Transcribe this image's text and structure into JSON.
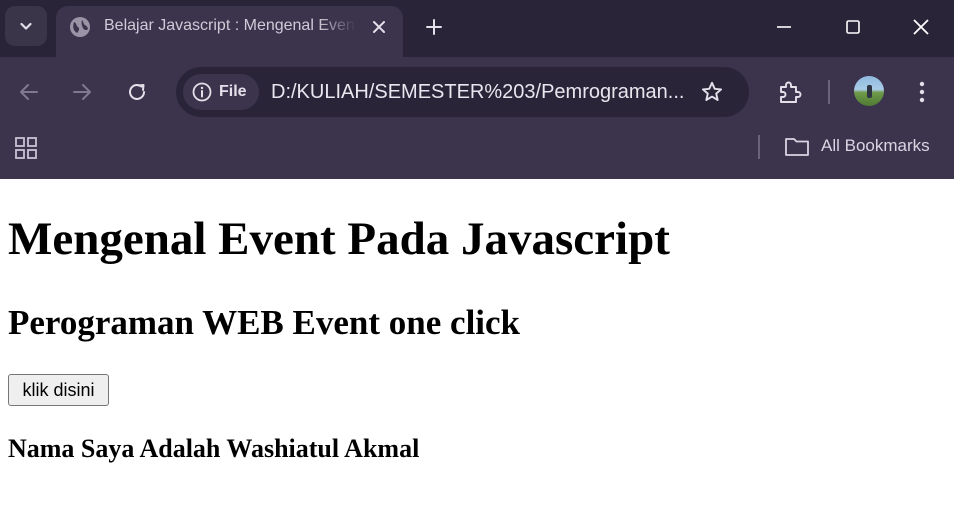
{
  "browser": {
    "tab": {
      "title": "Belajar Javascript : Mengenal Event Pada Javascript"
    },
    "address_bar": {
      "site_info_label": "File",
      "url": "D:/KULIAH/SEMESTER%203/Pemrograman..."
    },
    "bookmarks_bar": {
      "all_bookmarks_label": "All Bookmarks"
    },
    "icons": {
      "tab_search": "chevron-down-icon",
      "favicon": "globe-icon",
      "tab_close": "close-icon",
      "new_tab": "plus-icon",
      "minimize": "minimize-icon",
      "maximize": "maximize-icon",
      "close_window": "close-icon",
      "back": "arrow-left-icon",
      "forward": "arrow-right-icon",
      "reload": "reload-icon",
      "site_info": "info-icon",
      "bookmark_star": "star-icon",
      "extensions": "puzzle-icon",
      "menu": "kebab-menu-icon",
      "apps": "apps-grid-icon",
      "folder": "folder-icon"
    },
    "colors": {
      "frame": "#2a2438",
      "toolbar": "#3c344d",
      "icon": "#e3e0ea",
      "icon_disabled": "#7f788e"
    }
  },
  "page": {
    "heading": "Mengenal Event Pada Javascript",
    "subheading": "Perograman WEB Event one click",
    "button_label": "klik disini",
    "result_text": "Nama Saya Adalah Washiatul Akmal"
  }
}
